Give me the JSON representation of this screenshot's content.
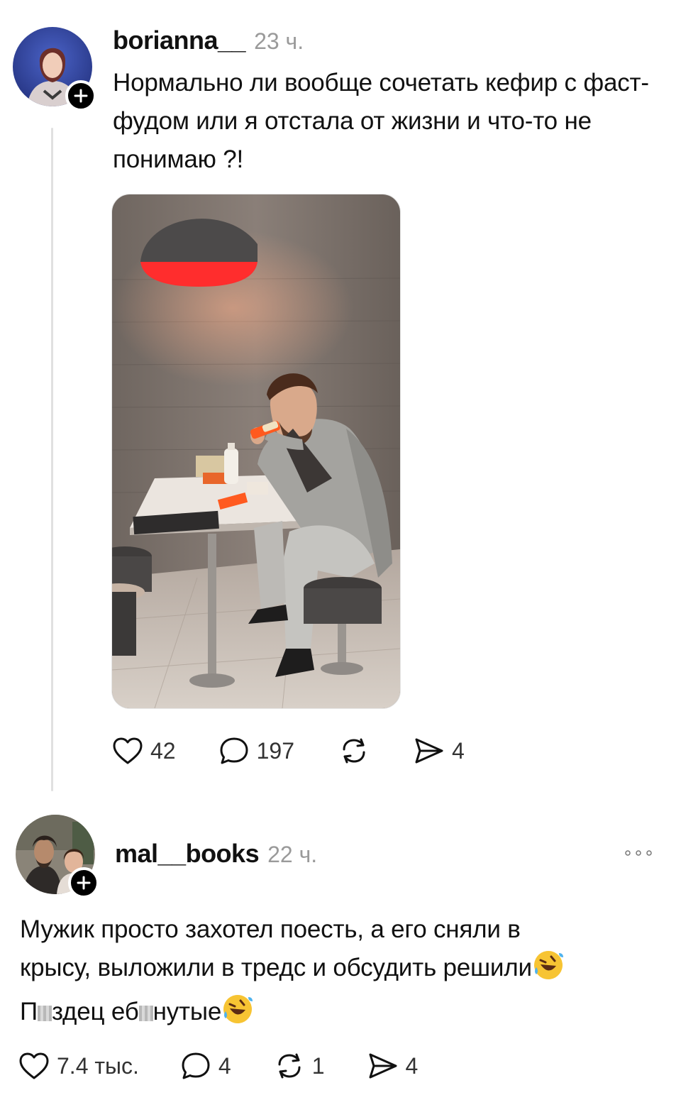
{
  "post": {
    "username": "borianna__",
    "time": "23 ч.",
    "text": "Нормально ли вообще сочетать кефир с фаст-фудом или я отстала от жизни и что-то не понимаю ?!",
    "likes": "42",
    "comments": "197",
    "shares": "4"
  },
  "reply": {
    "username": "mal__books",
    "time": "22 ч.",
    "text_line1": "Мужик просто захотел поесть, а его сняли в",
    "text_line2": "крысу, выложили в тредс и обсудить решили",
    "text_line3_a": "П",
    "text_line3_b": "здец еб",
    "text_line3_c": "нутые",
    "likes": "7.4 тыс.",
    "comments": "4",
    "reposts": "1",
    "shares": "4"
  },
  "icons": {
    "follow": "plus-icon",
    "like": "heart-icon",
    "comment": "comment-bubble-icon",
    "repost": "repost-icon",
    "share": "send-icon",
    "more": "more-dots-icon",
    "emoji": "rofl-emoji-icon"
  },
  "colors": {
    "text": "#111111",
    "muted": "#9a9a9a",
    "lamp_red": "#ff2d2d",
    "thread_line": "#e0e0e0"
  }
}
